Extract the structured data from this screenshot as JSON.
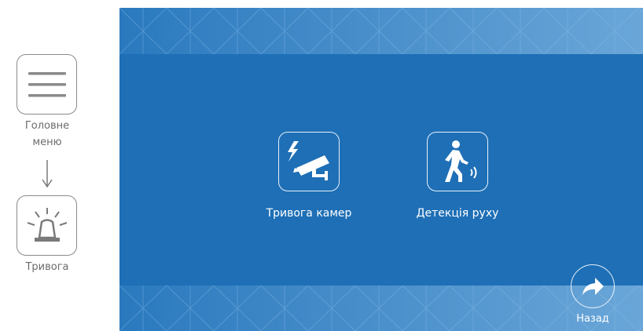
{
  "flow": {
    "main_menu_label": "Головне\nменю",
    "alarm_label": "Тривога"
  },
  "screen": {
    "menu_items": [
      {
        "label": "Тривога камер",
        "icon": "camera-alarm-icon"
      },
      {
        "label": "Детекція руху",
        "icon": "motion-detection-icon"
      }
    ],
    "back_label": "Назад"
  },
  "colors": {
    "screen_bg": "#1e6fb6",
    "band_light": "#4d95cf",
    "side_border": "#8a8a8a",
    "side_text": "#6b6b6b"
  }
}
